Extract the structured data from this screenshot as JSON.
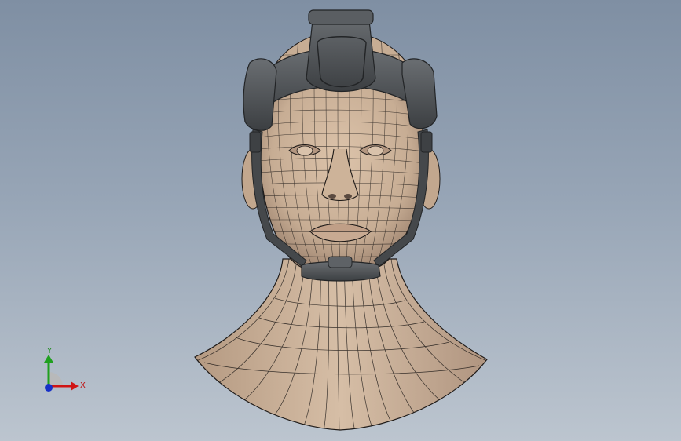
{
  "viewport": {
    "background_top": "#7f8fa3",
    "background_bottom": "#bcc5cf"
  },
  "model": {
    "skin_color": "#c7ad94",
    "wire_color": "#1e1a18",
    "gear_color": "#4a4d50",
    "gear_edge_color": "#222426"
  },
  "triad": {
    "x_label": "X",
    "y_label": "Y",
    "x_color": "#d01414",
    "y_color": "#1fa01f",
    "z_color": "#1630c8"
  }
}
